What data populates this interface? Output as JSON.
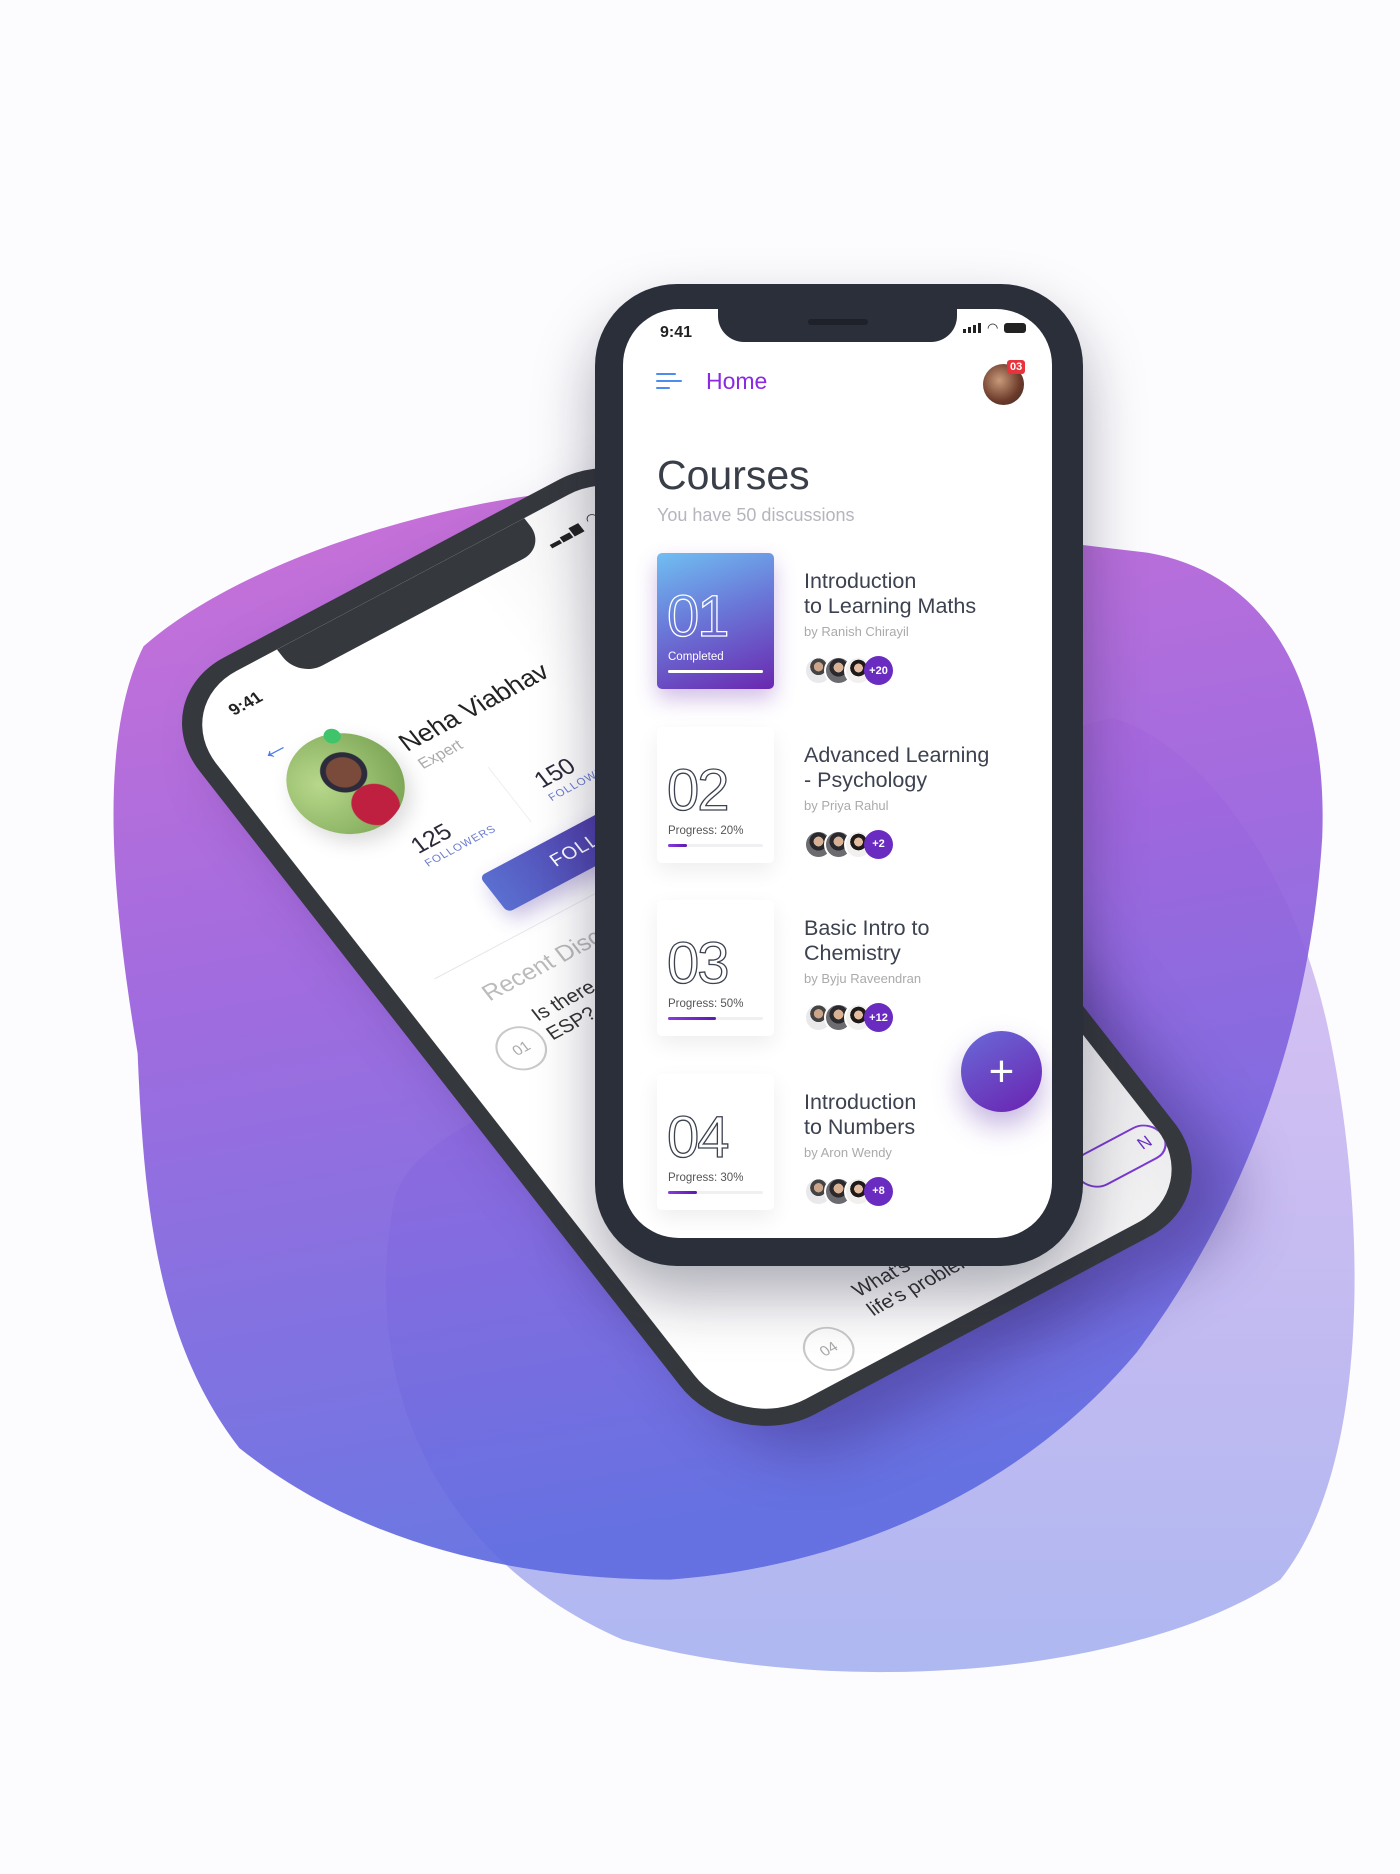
{
  "colors": {
    "accent": "#8a2be2",
    "badge": "#e8323c",
    "primary_purple": "#6a2cc0",
    "blob_top": "#c46ad6",
    "blob_bottom": "#5f6be0"
  },
  "back_phone": {
    "time": "9:41",
    "back_icon": "arrow-left-icon",
    "name": "Neha Viabhav",
    "role": "Expert",
    "followers": {
      "count": "125",
      "label": "FOLLOWERS"
    },
    "following": {
      "count": "150",
      "label": "FOLLOWING"
    },
    "follow_label": "FOLLOW",
    "section_title": "Recent Discussio",
    "discussions": [
      {
        "num": "01",
        "line1": "Is there",
        "line2": "ESP?"
      },
      {
        "num": "0"
      },
      {
        "num": "04",
        "line1": "What's th",
        "line2": "life's problem"
      }
    ],
    "partial_button": "N"
  },
  "front_phone": {
    "time": "9:41",
    "nav": {
      "menu_icon": "hamburger-icon",
      "title": "Home",
      "notification_count": "03"
    },
    "heading": "Courses",
    "subtitle": "You have 50 discussions",
    "courses": [
      {
        "num": "01",
        "status": "Completed",
        "progress": 100,
        "title_line1": "Introduction",
        "title_line2": "to Learning Maths",
        "author": "by Ranish Chirayil",
        "extra": "+20"
      },
      {
        "num": "02",
        "status": "Progress: 20%",
        "progress": 20,
        "title_line1": "Advanced  Learning",
        "title_line2": "- Psychology",
        "author": "by Priya Rahul",
        "extra": "+2"
      },
      {
        "num": "03",
        "status": "Progress: 50%",
        "progress": 50,
        "title_line1": "Basic Intro to",
        "title_line2": "Chemistry",
        "author": "by Byju Raveendran",
        "extra": "+12"
      },
      {
        "num": "04",
        "status": "Progress: 30%",
        "progress": 30,
        "title_line1": "Introduction",
        "title_line2": "to Numbers",
        "author": "by Aron Wendy",
        "extra": "+8"
      }
    ],
    "fab_icon": "plus-icon",
    "fab_label": "+"
  }
}
